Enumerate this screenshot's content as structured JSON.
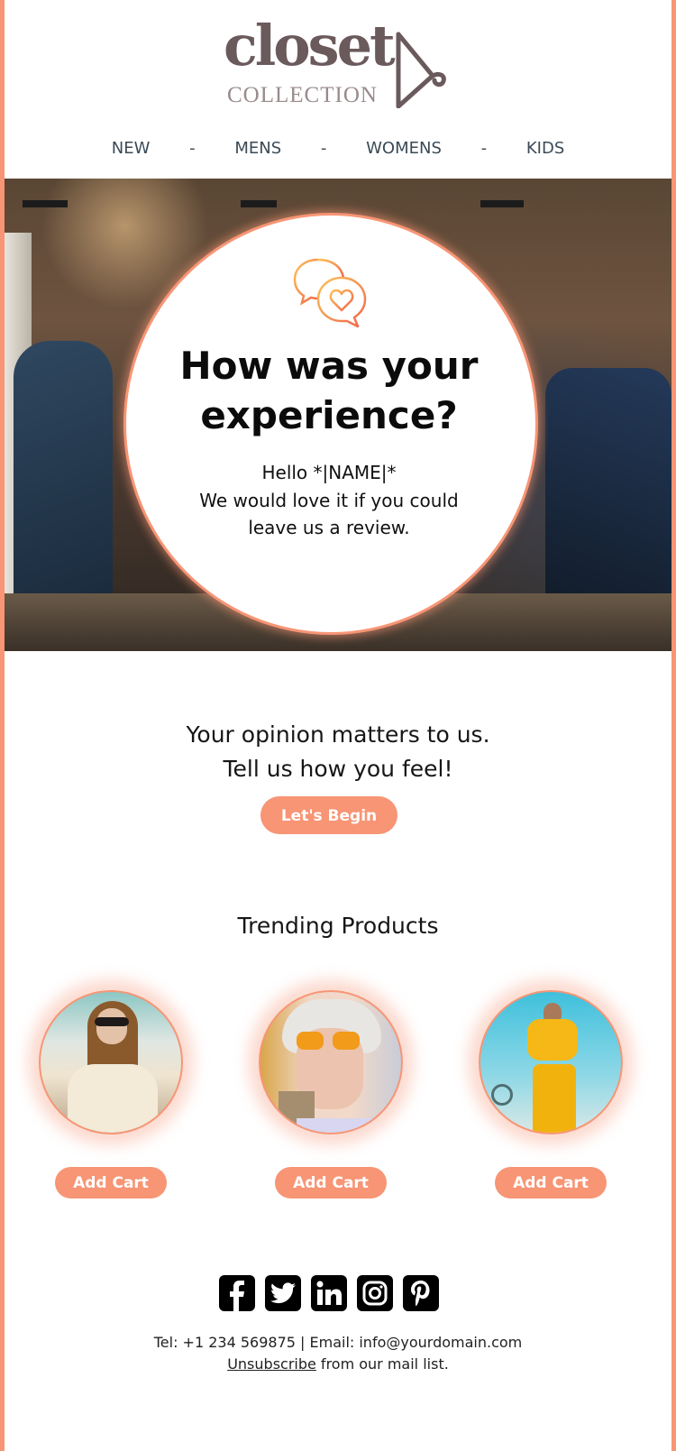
{
  "brand": {
    "logo_word": "closet",
    "logo_sub": "COLLECTION",
    "color_text": "#6b5a5c",
    "accent": "#f79575"
  },
  "nav": {
    "items": [
      {
        "label": "NEW"
      },
      {
        "label": "MENS"
      },
      {
        "label": "WOMENS"
      },
      {
        "label": "KIDS"
      }
    ],
    "separator": "-"
  },
  "hero": {
    "icon": "chat-heart-icon",
    "title": "How was your experience?",
    "greeting": "Hello *|NAME|*",
    "message_line1": "We would love it if you could",
    "message_line2": "leave us a review."
  },
  "opinion": {
    "line1": "Your opinion matters to us.",
    "line2": "Tell us how you feel!",
    "button_label": "Let's Begin"
  },
  "trending": {
    "title": "Trending Products",
    "products": [
      {
        "image": "woman-sunglasses-white-shirt",
        "button_label": "Add Cart"
      },
      {
        "image": "woman-orange-sunglasses-hat",
        "button_label": "Add Cart"
      },
      {
        "image": "woman-yellow-tracksuit",
        "button_label": "Add Cart"
      }
    ]
  },
  "social": {
    "icons": [
      "facebook-icon",
      "twitter-icon",
      "linkedin-icon",
      "instagram-icon",
      "pinterest-icon"
    ]
  },
  "footer": {
    "contact": "Tel: +1 234 569875 | Email: info@yourdomain.com",
    "unsubscribe_link": "Unsubscribe",
    "unsubscribe_rest": " from our mail list."
  }
}
